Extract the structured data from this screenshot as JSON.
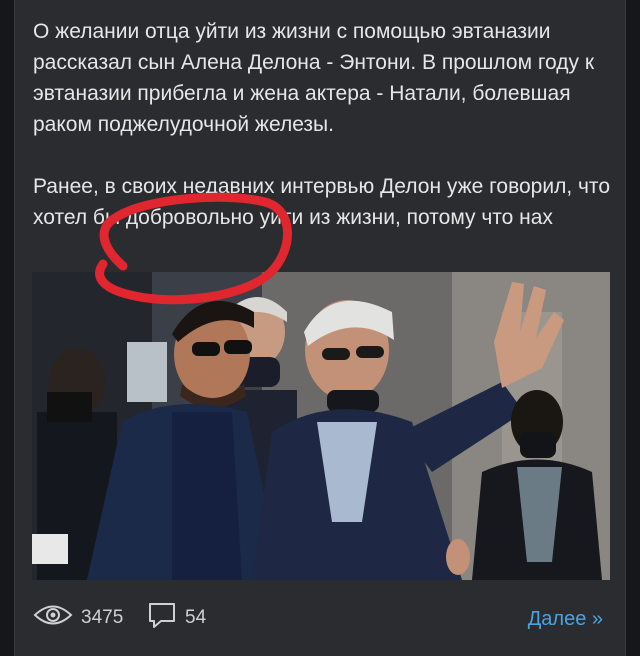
{
  "post": {
    "paragraphs": [
      "О желании отца уйти из жизни с помощью эвтаназии рассказал сын Алена Делона - Энтони. В прошлом году к эвтаназии прибегла и жена актера - Натали, болевшая раком поджелудочной железы.",
      "Ранее, в своих недавних интервью Делон уже говорил, что хотел бы добровольно уйти из жизни, потому что нах"
    ]
  },
  "footer": {
    "views_icon": "eye-icon",
    "views": "3475",
    "comments_icon": "comment-icon",
    "comments": "54",
    "more_label": "Далее »"
  },
  "colors": {
    "page_bg": "#161719",
    "card_bg": "#2b2c30",
    "text": "#e6e6e6",
    "link": "#4aa3e0",
    "scribble": "#e0262e"
  }
}
